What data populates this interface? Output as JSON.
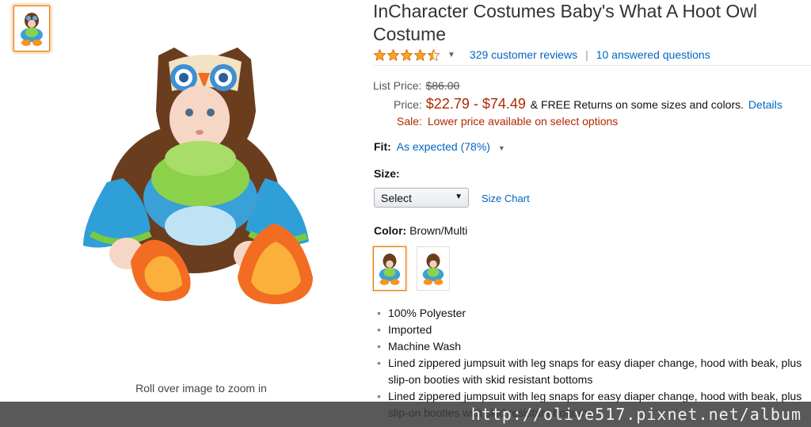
{
  "product": {
    "title": "InCharacter Costumes Baby's What A Hoot Owl Costume",
    "rating_icon": "star-rating-4.5",
    "reviews_link": "329 customer reviews",
    "separator": "|",
    "questions_link": "10 answered questions"
  },
  "gallery": {
    "zoom_hint": "Roll over image to zoom in"
  },
  "pricing": {
    "list_price_label": "List Price:",
    "list_price": "$86.00",
    "price_label": "Price:",
    "price": "$22.79 - $74.49",
    "returns_text": "& FREE Returns on some sizes and colors.",
    "details_link": "Details",
    "sale_label": "Sale:",
    "sale_text": "Lower price available on select options"
  },
  "fit": {
    "label": "Fit:",
    "value": "As expected (78%)"
  },
  "size": {
    "label": "Size:",
    "selected": "Select",
    "chart_link": "Size Chart"
  },
  "color": {
    "label": "Color:",
    "value": "Brown/Multi"
  },
  "features": [
    "100% Polyester",
    "Imported",
    "Machine Wash",
    "Lined zippered jumpsuit with leg snaps for easy diaper change, hood with beak, plus slip-on booties with skid resistant bottoms",
    "Lined zippered jumpsuit with leg snaps for easy diaper change, hood with beak, plus slip-on booties with skid resistant bottoms"
  ],
  "watermark": "http://olive517.pixnet.net/album",
  "colors": {
    "link": "#0066c0",
    "price": "#b12704",
    "star": "#ffa41c",
    "selected_border": "#e77600"
  }
}
